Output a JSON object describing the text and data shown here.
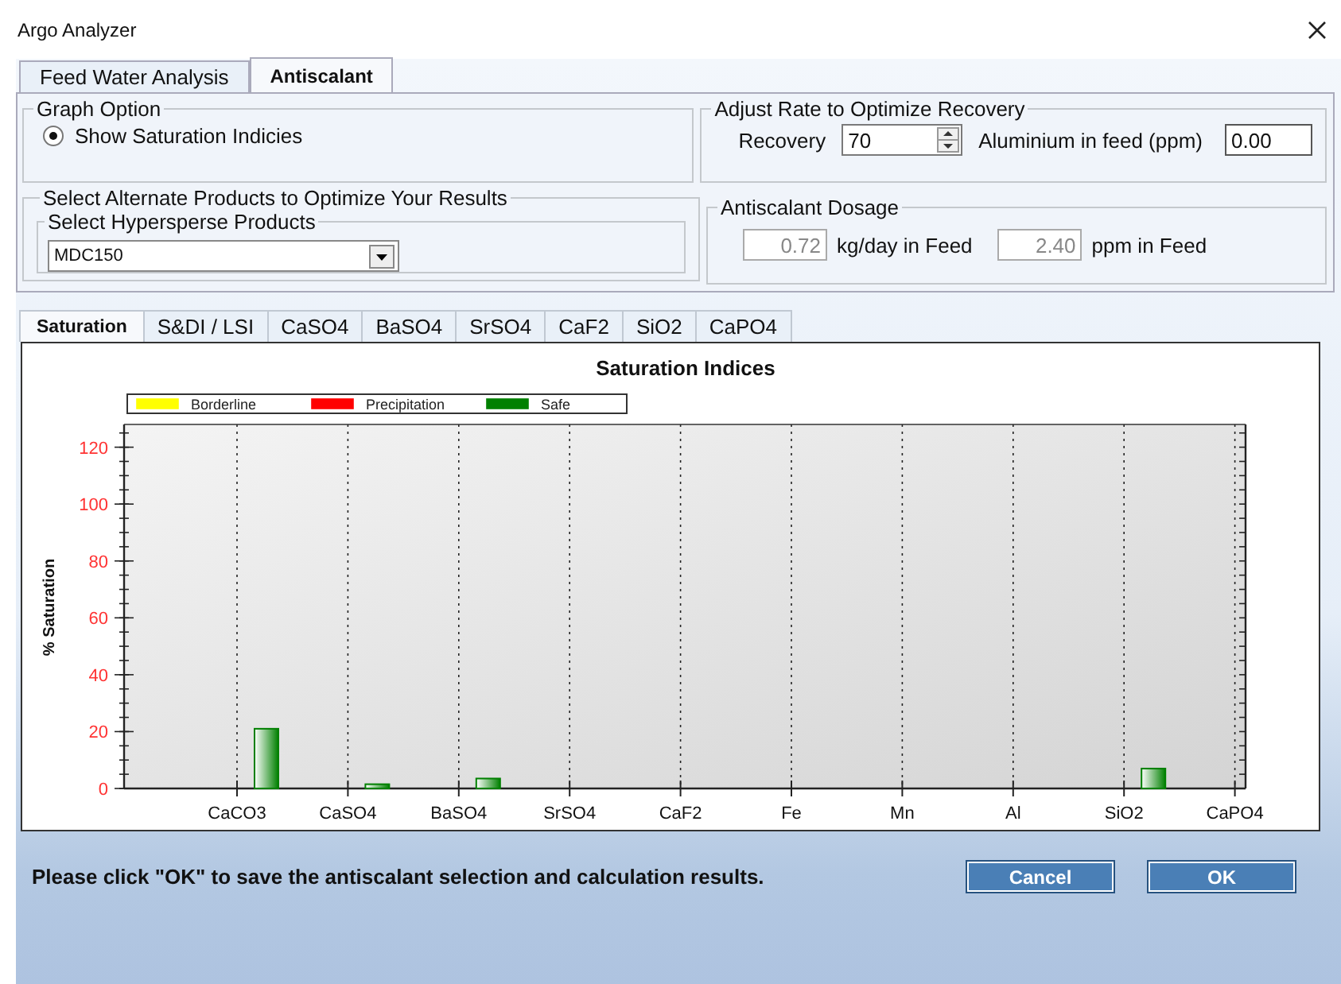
{
  "window": {
    "title": "Argo Analyzer"
  },
  "top_tabs": [
    {
      "label": "Feed Water Analysis",
      "selected": false
    },
    {
      "label": "Antiscalant",
      "selected": true
    }
  ],
  "graph_option": {
    "title": "Graph Option",
    "radio": {
      "label": "Show Saturation Indicies",
      "selected": true
    }
  },
  "recovery_group": {
    "title": "Adjust Rate to Optimize Recovery",
    "recovery_label": "Recovery",
    "recovery_value": "70",
    "aluminium_label": "Aluminium in feed (ppm)",
    "aluminium_value": "0.00"
  },
  "products_group": {
    "title": "Select Alternate Products to Optimize Your Results",
    "subtitle": "Select Hypersperse Products",
    "product_value": "MDC150"
  },
  "dosage_group": {
    "title": "Antiscalant Dosage",
    "kg_value": "0.72",
    "kg_label": "kg/day in Feed",
    "ppm_value": "2.40",
    "ppm_label": "ppm in Feed"
  },
  "chart_tabs": [
    {
      "label": "Saturation",
      "selected": true
    },
    {
      "label": "S&DI / LSI",
      "selected": false
    },
    {
      "label": "CaSO4",
      "selected": false
    },
    {
      "label": "BaSO4",
      "selected": false
    },
    {
      "label": "SrSO4",
      "selected": false
    },
    {
      "label": "CaF2",
      "selected": false
    },
    {
      "label": "SiO2",
      "selected": false
    },
    {
      "label": "CaPO4",
      "selected": false
    }
  ],
  "chart": {
    "chart_data": {
      "type": "bar",
      "title": "Saturation Indices",
      "ylabel": "% Saturation",
      "categories": [
        "CaCO3",
        "CaSO4",
        "BaSO4",
        "SrSO4",
        "CaF2",
        "Fe",
        "Mn",
        "Al",
        "SiO2",
        "CaPO4"
      ],
      "ylim": [
        0,
        128
      ],
      "grid": true,
      "yticks": [
        0,
        20,
        40,
        60,
        80,
        100,
        120
      ],
      "series": [
        {
          "name": "Borderline",
          "color": "#ffff00",
          "values": [
            null,
            null,
            null,
            null,
            null,
            null,
            null,
            null,
            null,
            null
          ]
        },
        {
          "name": "Precipitation",
          "color": "#ff0000",
          "values": [
            null,
            null,
            null,
            null,
            null,
            null,
            null,
            null,
            null,
            null
          ]
        },
        {
          "name": "Safe",
          "color": "#008000",
          "values": [
            21,
            1.5,
            3.5,
            0,
            0,
            0,
            0,
            0,
            7,
            0
          ]
        }
      ]
    }
  },
  "footer": {
    "message": "Please click \"OK\" to save the antiscalant selection and calculation results.",
    "buttons": [
      "Cancel",
      "OK"
    ]
  }
}
